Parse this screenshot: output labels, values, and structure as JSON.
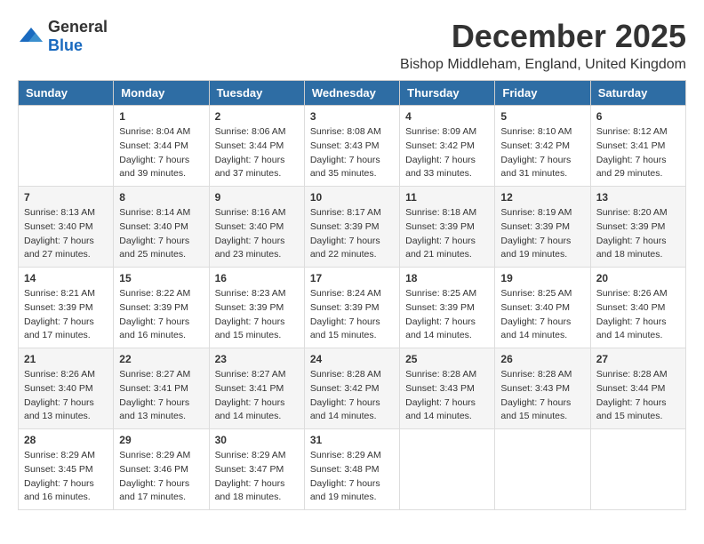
{
  "logo": {
    "general": "General",
    "blue": "Blue"
  },
  "title": {
    "month": "December 2025",
    "location": "Bishop Middleham, England, United Kingdom"
  },
  "weekdays": [
    "Sunday",
    "Monday",
    "Tuesday",
    "Wednesday",
    "Thursday",
    "Friday",
    "Saturday"
  ],
  "weeks": [
    [
      {
        "day": "",
        "sunrise": "",
        "sunset": "",
        "daylight": ""
      },
      {
        "day": "1",
        "sunrise": "Sunrise: 8:04 AM",
        "sunset": "Sunset: 3:44 PM",
        "daylight": "Daylight: 7 hours and 39 minutes."
      },
      {
        "day": "2",
        "sunrise": "Sunrise: 8:06 AM",
        "sunset": "Sunset: 3:44 PM",
        "daylight": "Daylight: 7 hours and 37 minutes."
      },
      {
        "day": "3",
        "sunrise": "Sunrise: 8:08 AM",
        "sunset": "Sunset: 3:43 PM",
        "daylight": "Daylight: 7 hours and 35 minutes."
      },
      {
        "day": "4",
        "sunrise": "Sunrise: 8:09 AM",
        "sunset": "Sunset: 3:42 PM",
        "daylight": "Daylight: 7 hours and 33 minutes."
      },
      {
        "day": "5",
        "sunrise": "Sunrise: 8:10 AM",
        "sunset": "Sunset: 3:42 PM",
        "daylight": "Daylight: 7 hours and 31 minutes."
      },
      {
        "day": "6",
        "sunrise": "Sunrise: 8:12 AM",
        "sunset": "Sunset: 3:41 PM",
        "daylight": "Daylight: 7 hours and 29 minutes."
      }
    ],
    [
      {
        "day": "7",
        "sunrise": "Sunrise: 8:13 AM",
        "sunset": "Sunset: 3:40 PM",
        "daylight": "Daylight: 7 hours and 27 minutes."
      },
      {
        "day": "8",
        "sunrise": "Sunrise: 8:14 AM",
        "sunset": "Sunset: 3:40 PM",
        "daylight": "Daylight: 7 hours and 25 minutes."
      },
      {
        "day": "9",
        "sunrise": "Sunrise: 8:16 AM",
        "sunset": "Sunset: 3:40 PM",
        "daylight": "Daylight: 7 hours and 23 minutes."
      },
      {
        "day": "10",
        "sunrise": "Sunrise: 8:17 AM",
        "sunset": "Sunset: 3:39 PM",
        "daylight": "Daylight: 7 hours and 22 minutes."
      },
      {
        "day": "11",
        "sunrise": "Sunrise: 8:18 AM",
        "sunset": "Sunset: 3:39 PM",
        "daylight": "Daylight: 7 hours and 21 minutes."
      },
      {
        "day": "12",
        "sunrise": "Sunrise: 8:19 AM",
        "sunset": "Sunset: 3:39 PM",
        "daylight": "Daylight: 7 hours and 19 minutes."
      },
      {
        "day": "13",
        "sunrise": "Sunrise: 8:20 AM",
        "sunset": "Sunset: 3:39 PM",
        "daylight": "Daylight: 7 hours and 18 minutes."
      }
    ],
    [
      {
        "day": "14",
        "sunrise": "Sunrise: 8:21 AM",
        "sunset": "Sunset: 3:39 PM",
        "daylight": "Daylight: 7 hours and 17 minutes."
      },
      {
        "day": "15",
        "sunrise": "Sunrise: 8:22 AM",
        "sunset": "Sunset: 3:39 PM",
        "daylight": "Daylight: 7 hours and 16 minutes."
      },
      {
        "day": "16",
        "sunrise": "Sunrise: 8:23 AM",
        "sunset": "Sunset: 3:39 PM",
        "daylight": "Daylight: 7 hours and 15 minutes."
      },
      {
        "day": "17",
        "sunrise": "Sunrise: 8:24 AM",
        "sunset": "Sunset: 3:39 PM",
        "daylight": "Daylight: 7 hours and 15 minutes."
      },
      {
        "day": "18",
        "sunrise": "Sunrise: 8:25 AM",
        "sunset": "Sunset: 3:39 PM",
        "daylight": "Daylight: 7 hours and 14 minutes."
      },
      {
        "day": "19",
        "sunrise": "Sunrise: 8:25 AM",
        "sunset": "Sunset: 3:40 PM",
        "daylight": "Daylight: 7 hours and 14 minutes."
      },
      {
        "day": "20",
        "sunrise": "Sunrise: 8:26 AM",
        "sunset": "Sunset: 3:40 PM",
        "daylight": "Daylight: 7 hours and 14 minutes."
      }
    ],
    [
      {
        "day": "21",
        "sunrise": "Sunrise: 8:26 AM",
        "sunset": "Sunset: 3:40 PM",
        "daylight": "Daylight: 7 hours and 13 minutes."
      },
      {
        "day": "22",
        "sunrise": "Sunrise: 8:27 AM",
        "sunset": "Sunset: 3:41 PM",
        "daylight": "Daylight: 7 hours and 13 minutes."
      },
      {
        "day": "23",
        "sunrise": "Sunrise: 8:27 AM",
        "sunset": "Sunset: 3:41 PM",
        "daylight": "Daylight: 7 hours and 14 minutes."
      },
      {
        "day": "24",
        "sunrise": "Sunrise: 8:28 AM",
        "sunset": "Sunset: 3:42 PM",
        "daylight": "Daylight: 7 hours and 14 minutes."
      },
      {
        "day": "25",
        "sunrise": "Sunrise: 8:28 AM",
        "sunset": "Sunset: 3:43 PM",
        "daylight": "Daylight: 7 hours and 14 minutes."
      },
      {
        "day": "26",
        "sunrise": "Sunrise: 8:28 AM",
        "sunset": "Sunset: 3:43 PM",
        "daylight": "Daylight: 7 hours and 15 minutes."
      },
      {
        "day": "27",
        "sunrise": "Sunrise: 8:28 AM",
        "sunset": "Sunset: 3:44 PM",
        "daylight": "Daylight: 7 hours and 15 minutes."
      }
    ],
    [
      {
        "day": "28",
        "sunrise": "Sunrise: 8:29 AM",
        "sunset": "Sunset: 3:45 PM",
        "daylight": "Daylight: 7 hours and 16 minutes."
      },
      {
        "day": "29",
        "sunrise": "Sunrise: 8:29 AM",
        "sunset": "Sunset: 3:46 PM",
        "daylight": "Daylight: 7 hours and 17 minutes."
      },
      {
        "day": "30",
        "sunrise": "Sunrise: 8:29 AM",
        "sunset": "Sunset: 3:47 PM",
        "daylight": "Daylight: 7 hours and 18 minutes."
      },
      {
        "day": "31",
        "sunrise": "Sunrise: 8:29 AM",
        "sunset": "Sunset: 3:48 PM",
        "daylight": "Daylight: 7 hours and 19 minutes."
      },
      {
        "day": "",
        "sunrise": "",
        "sunset": "",
        "daylight": ""
      },
      {
        "day": "",
        "sunrise": "",
        "sunset": "",
        "daylight": ""
      },
      {
        "day": "",
        "sunrise": "",
        "sunset": "",
        "daylight": ""
      }
    ]
  ]
}
